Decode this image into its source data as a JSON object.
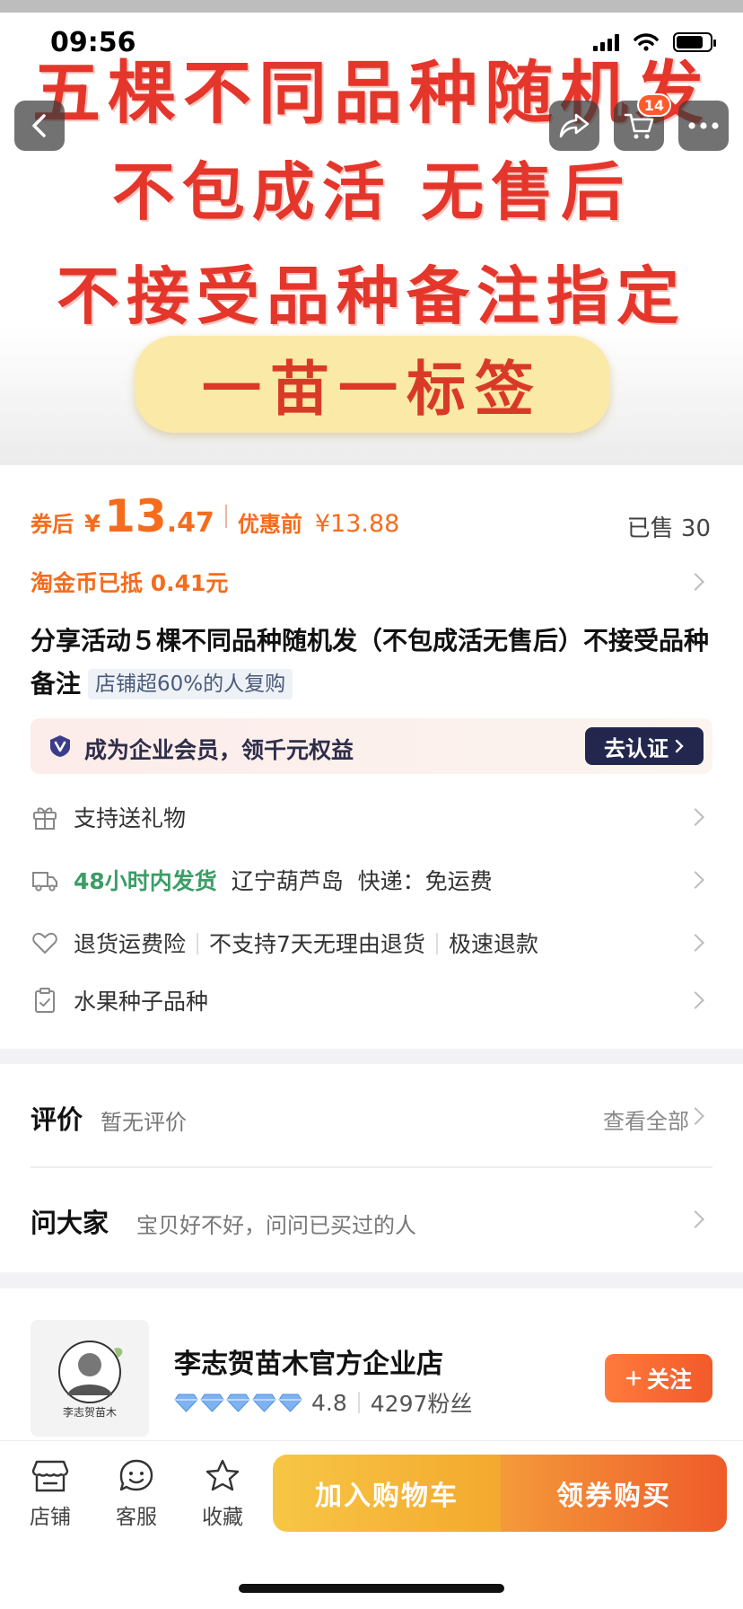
{
  "status_bar": {
    "time": "09:56"
  },
  "hero": {
    "line1": "五棵不同品种随机发",
    "line2": "不包成活 无售后",
    "line3": "不接受品种备注指定",
    "pill": "一苗一标签"
  },
  "nav": {
    "cart_count": "14"
  },
  "price": {
    "after_coupon_label": "券后",
    "currency": "¥",
    "integer": "13",
    "decimal": ".47",
    "before_label": "优惠前",
    "before_price": "¥13.88",
    "sold": "已售 30"
  },
  "coin_text": "淘金币已抵 0.41元",
  "product": {
    "title": "分享活动５棵不同品种随机发（不包成活无售后）不接受品种备注",
    "repurchase_tag": "店铺超60%的人复购"
  },
  "member": {
    "text": "成为企业会员，领千元权益",
    "button": "去认证"
  },
  "services": {
    "gift": "支持送礼物",
    "ship_time": "48小时内发货",
    "ship_location": "辽宁葫芦岛",
    "ship_fee": "快递：免运费",
    "return_insurance": "退货运费险",
    "no_return": "不支持7天无理由退货",
    "fast_refund": "极速退款",
    "category": "水果种子品种"
  },
  "reviews": {
    "title": "评价",
    "empty": "暂无评价",
    "view_all": "查看全部"
  },
  "ask": {
    "title": "问大家",
    "prompt": "宝贝好不好，问问已买过的人"
  },
  "shop": {
    "name": "李志贺苗木官方企业店",
    "rating": "4.8",
    "fans": "4297粉丝",
    "follow": "关注",
    "logo_text": "李志贺苗木"
  },
  "bottom": {
    "store": "店铺",
    "service": "客服",
    "favorite": "收藏",
    "add_cart": "加入购物车",
    "buy": "领券购买"
  },
  "colors": {
    "accent": "#f56c1d",
    "hero_red": "#e4362b",
    "dark_navy": "#23264d",
    "green": "#3a9e66"
  }
}
